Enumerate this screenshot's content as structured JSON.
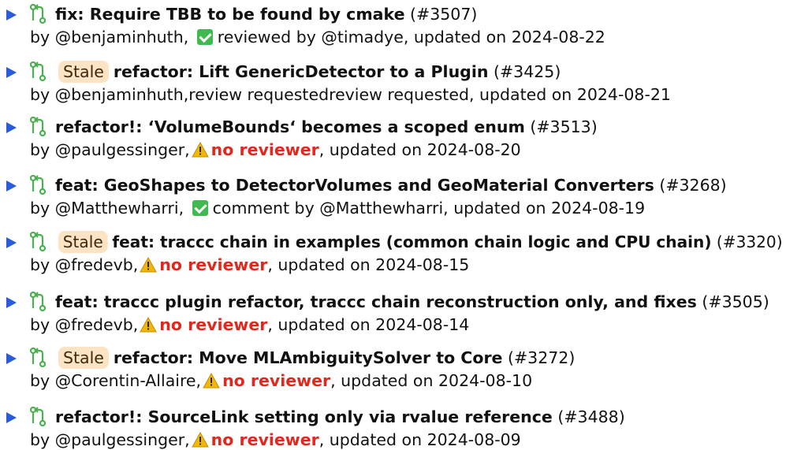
{
  "colors": {
    "caret": "#2a5bd8",
    "pr_icon": "#4caf50",
    "stale_bg": "#fbe3c4",
    "approved": "#3fb950",
    "warning": "#f2b705",
    "no_reviewer": "#e0281f"
  },
  "icons": {
    "expand": "caret-right-icon",
    "pr": "pull-request-icon",
    "approved": "check-box-icon",
    "warning": "warning-icon"
  },
  "prs": [
    {
      "title": "fix: Require TBB to be found by cmake",
      "number": "(#3507)",
      "stale": "",
      "meta_prefix": "by @benjaminhuth,",
      "status": "approved",
      "status_text": "reviewed by @timadye, updated on 2024-08-22"
    },
    {
      "title": "refactor: Lift GenericDetector to a Plugin",
      "number": "(#3425)",
      "stale": "Stale",
      "meta_prefix": "by @benjaminhuth,review requestedreview requested, updated on 2024-08-21",
      "status": "none",
      "status_text": ""
    },
    {
      "title": "refactor!: ‘VolumeBounds‘ becomes a scoped enum",
      "number": "(#3513)",
      "stale": "",
      "meta_prefix": "by @paulgessinger,",
      "status": "warning",
      "status_label": "no reviewer",
      "status_text": ", updated on 2024-08-20"
    },
    {
      "title": "feat: GeoShapes to DetectorVolumes and GeoMaterial Converters",
      "number": "(#3268)",
      "stale": "",
      "meta_prefix": "by @Matthewharri,",
      "status": "approved",
      "status_text": "comment by @Matthewharri, updated on 2024-08-19"
    },
    {
      "title": "feat: traccc chain in examples (common chain logic and CPU chain)",
      "number": "(#3320)",
      "stale": "Stale",
      "meta_prefix": "by @fredevb,",
      "status": "warning",
      "status_label": "no reviewer",
      "status_text": ", updated on 2024-08-15"
    },
    {
      "title": "feat: traccc plugin refactor, traccc chain reconstruction only, and fixes",
      "number": "(#3505)",
      "stale": "",
      "meta_prefix": "by @fredevb,",
      "status": "warning",
      "status_label": "no reviewer",
      "status_text": ", updated on 2024-08-14"
    },
    {
      "title": "refactor: Move MLAmbiguitySolver to Core",
      "number": "(#3272)",
      "stale": "Stale",
      "meta_prefix": "by @Corentin-Allaire,",
      "status": "warning",
      "status_label": "no reviewer",
      "status_text": ", updated on 2024-08-10"
    },
    {
      "title": "refactor!: SourceLink setting only via rvalue reference",
      "number": "(#3488)",
      "stale": "",
      "meta_prefix": "by @paulgessinger,",
      "status": "warning",
      "status_label": "no reviewer",
      "status_text": ", updated on 2024-08-09"
    }
  ]
}
